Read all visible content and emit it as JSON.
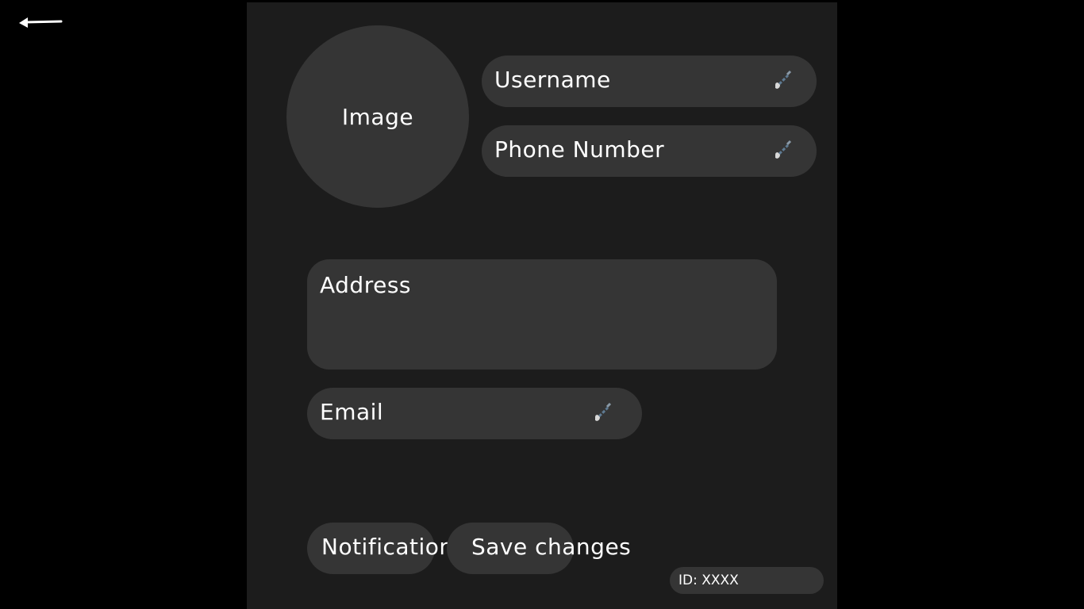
{
  "nav": {
    "back_icon": "arrow-left-icon"
  },
  "profile": {
    "avatar_label": "Image",
    "username_label": "Username",
    "phone_label": "Phone Number",
    "address_label": "Address",
    "email_label": "Email",
    "edit_icon": "pencil-icon"
  },
  "actions": {
    "notifications_label": "Notifications",
    "save_label": "Save changes"
  },
  "footer": {
    "id_text": "ID: XXXX"
  },
  "colors": {
    "page_background": "#000000",
    "panel_background": "#1c1c1c",
    "field_background": "#353535",
    "text": "#ffffff",
    "edit_icon_accent": "#5f7b93"
  }
}
